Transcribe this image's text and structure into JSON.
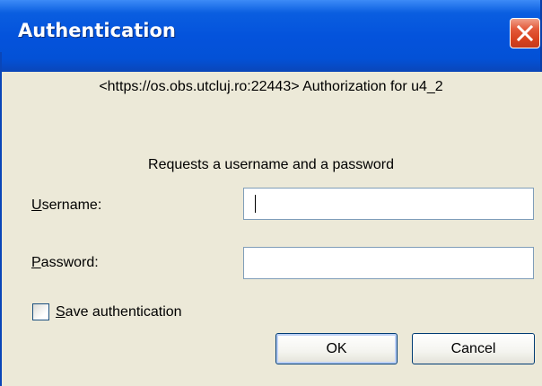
{
  "window": {
    "title": "Authentication"
  },
  "dialog": {
    "message": "<https://os.obs.utcluj.ro:22443> Authorization for u4_2",
    "subheading": "Requests a username and a password",
    "username": {
      "label_accel": "U",
      "label_rest": "sername:",
      "value": ""
    },
    "password": {
      "label_accel": "P",
      "label_rest": "assword:",
      "value": ""
    },
    "save_auth": {
      "label_accel": "S",
      "label_rest": "ave authentication",
      "checked": false
    },
    "buttons": {
      "ok": "OK",
      "cancel": "Cancel"
    }
  },
  "icons": {
    "close": "close-icon"
  },
  "colors": {
    "titlebar": "#0453dc",
    "close": "#d8431f",
    "background": "#ece9d8"
  }
}
